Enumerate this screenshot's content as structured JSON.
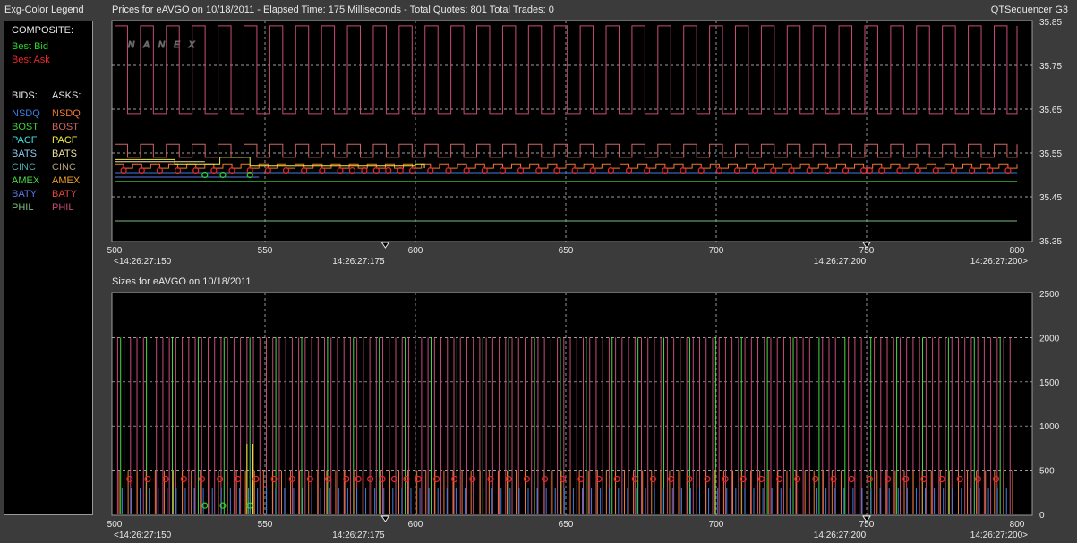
{
  "legend": {
    "title": "Exg-Color Legend",
    "composite_label": "COMPOSITE:",
    "best_bid": {
      "label": "Best Bid",
      "color": "#2cd72c"
    },
    "best_ask": {
      "label": "Best Ask",
      "color": "#e82828"
    },
    "bids_header": "BIDS:",
    "asks_header": "ASKS:",
    "exchanges": [
      {
        "name": "NSDQ",
        "bid_color": "#3b7fe0",
        "ask_color": "#f07a30"
      },
      {
        "name": "BOST",
        "bid_color": "#3cd23c",
        "ask_color": "#d06464"
      },
      {
        "name": "PACF",
        "bid_color": "#3fe0e0",
        "ask_color": "#f0f040"
      },
      {
        "name": "BATS",
        "bid_color": "#8cc8f0",
        "ask_color": "#f0e0a0"
      },
      {
        "name": "CINC",
        "bid_color": "#4aa8a8",
        "ask_color": "#b4a078"
      },
      {
        "name": "AMEX",
        "bid_color": "#44dc44",
        "ask_color": "#f0a028"
      },
      {
        "name": "BATY",
        "bid_color": "#5a78e6",
        "ask_color": "#e84b3c"
      },
      {
        "name": "PHIL",
        "bid_color": "#7cbc7c",
        "ask_color": "#c84b7a"
      }
    ]
  },
  "prices_title": "Prices for  eAVGO  on  10/18/2011   -  Elapsed Time: 175 Milliseconds  -  Total Quotes: 801   Total Trades: 0",
  "sizes_title": "Sizes for  eAVGO  on  10/18/2011",
  "brand": "QTSequencer G3",
  "watermark": "NANEX",
  "chart_data": [
    {
      "type": "line",
      "name": "prices",
      "xlim": [
        500,
        800
      ],
      "ylim": [
        35.35,
        35.85
      ],
      "x_ticks": [
        500,
        550,
        600,
        650,
        700,
        750,
        800
      ],
      "y_ticks": [
        35.35,
        35.45,
        35.55,
        35.65,
        35.75,
        35.85
      ],
      "y_tick_labels": [
        "35.35",
        "35.45",
        "35.55",
        "35.65",
        "35.75",
        "35.85"
      ],
      "time_labels": [
        {
          "x": 500,
          "text": "<14:26:27:150"
        },
        {
          "x": 590,
          "text": "14:26:27:175"
        },
        {
          "x": 750,
          "text": "14:26:27:200"
        },
        {
          "x": 800,
          "text": "14:26:27:200>"
        }
      ],
      "grid": true,
      "series": [
        {
          "exchange": "PHIL",
          "side": "ask",
          "color": "#c84b7a",
          "toggle_levels": [
            35.84,
            35.64
          ],
          "x_start": 500,
          "x_end": 800,
          "period": 4.3
        },
        {
          "exchange": "BOST",
          "side": "ask",
          "color": "#d06464",
          "toggle_levels": [
            35.57,
            35.54
          ],
          "x_start": 500,
          "x_end": 800,
          "period": 4.3
        },
        {
          "exchange": "NSDQ",
          "side": "ask",
          "color": "#f07a30",
          "toggle_levels": [
            35.525,
            35.515
          ],
          "x_start": 500,
          "x_end": 800,
          "period": 3.0
        },
        {
          "exchange": "PACF",
          "side": "ask",
          "color": "#f0f040",
          "steps": [
            [
              500,
              35.535
            ],
            [
              520,
              35.535
            ],
            [
              520,
              35.525
            ],
            [
              535,
              35.525
            ],
            [
              535,
              35.54
            ],
            [
              545,
              35.54
            ],
            [
              545,
              35.52
            ],
            [
              600,
              35.52
            ],
            [
              600,
              35.525
            ],
            [
              603,
              35.525
            ],
            [
              603,
              35.515
            ]
          ]
        },
        {
          "exchange": "BATS",
          "side": "ask",
          "color": "#f0e0a0",
          "steps": [
            [
              500,
              35.53
            ],
            [
              530,
              35.53
            ]
          ]
        },
        {
          "exchange": "NSDQ",
          "side": "bid",
          "color": "#3b7fe0",
          "steps": [
            [
              500,
              35.505
            ],
            [
              620,
              35.505
            ],
            [
              750,
              35.505
            ],
            [
              800,
              35.505
            ]
          ]
        },
        {
          "exchange": "BATY",
          "side": "bid",
          "color": "#5a78e6",
          "steps": [
            [
              500,
              35.495
            ],
            [
              548,
              35.495
            ]
          ]
        },
        {
          "exchange": "AMEX",
          "side": "bid",
          "color": "#44dc44",
          "steps": [
            [
              500,
              35.485
            ],
            [
              800,
              35.485
            ]
          ]
        },
        {
          "exchange": "PHIL",
          "side": "bid",
          "color": "#7cbc7c",
          "steps": [
            [
              500,
              35.395
            ],
            [
              800,
              35.395
            ]
          ]
        }
      ],
      "best_ask_markers": {
        "color": "#e82828",
        "level": 35.51,
        "x": [
          503,
          509,
          515,
          521,
          527,
          533,
          539,
          545,
          551,
          557,
          563,
          569,
          575,
          579,
          583,
          587,
          591,
          595,
          599,
          605,
          611,
          617,
          623,
          629,
          635,
          641,
          647,
          653,
          659,
          665,
          671,
          677,
          683,
          689,
          695,
          701,
          707,
          713,
          719,
          725,
          731,
          737,
          743,
          749,
          751,
          755,
          761,
          767,
          773,
          779,
          785,
          791,
          797
        ]
      },
      "best_bid_markers": {
        "color": "#2cd72c",
        "level": 35.5,
        "x": [
          530,
          536,
          545
        ]
      }
    },
    {
      "type": "bar",
      "name": "sizes",
      "xlim": [
        500,
        800
      ],
      "ylim": [
        0,
        2500
      ],
      "x_ticks": [
        500,
        550,
        600,
        650,
        700,
        750,
        800
      ],
      "y_ticks": [
        0,
        500,
        1000,
        1500,
        2000,
        2500
      ],
      "y_tick_labels": [
        "0",
        "500",
        "1000",
        "1500",
        "2000",
        "2500"
      ],
      "time_labels": [
        {
          "x": 500,
          "text": "<14:26:27:150"
        },
        {
          "x": 590,
          "text": "14:26:27:175"
        },
        {
          "x": 750,
          "text": "14:26:27:200"
        },
        {
          "x": 800,
          "text": "14:26:27:200>"
        }
      ],
      "grid": true,
      "series": [
        {
          "exchange": "PHIL",
          "side": "ask",
          "color": "#c84b7a",
          "value": 2000,
          "x_start": 501,
          "x_end": 799,
          "spacing": 2.15
        },
        {
          "exchange": "AMEX",
          "side": "bid",
          "color": "#44dc44",
          "value": 2000,
          "x_start": 502,
          "x_end": 799,
          "spacing": 8.6
        },
        {
          "exchange": "NSDQ",
          "side": "ask",
          "color": "#f07a30",
          "value": 500,
          "x_start": 501.5,
          "x_end": 799,
          "spacing": 3.0
        },
        {
          "exchange": "NSDQ",
          "side": "bid",
          "color": "#3b7fe0",
          "value": 300,
          "x_start": 502.5,
          "x_end": 799,
          "spacing": 3.0
        },
        {
          "exchange": "PACF",
          "side": "ask",
          "color": "#f0f040",
          "value": 800,
          "x_start": 544,
          "x_end": 546,
          "spacing": 2.0
        }
      ],
      "best_ask_markers": {
        "color": "#e82828",
        "level": 400,
        "x": [
          505,
          511,
          517,
          523,
          529,
          535,
          541,
          547,
          553,
          559,
          565,
          571,
          577,
          581,
          585,
          589,
          593,
          597,
          601,
          607,
          613,
          619,
          625,
          631,
          637,
          643,
          649,
          655,
          661,
          667,
          673,
          679,
          685,
          691,
          697,
          703,
          709,
          715,
          721,
          727,
          733,
          739,
          745,
          751,
          757,
          763,
          769,
          775,
          781,
          787,
          793
        ]
      },
      "best_bid_markers": {
        "color": "#2cd72c",
        "level": 100,
        "x": [
          530,
          536,
          545
        ]
      }
    }
  ]
}
